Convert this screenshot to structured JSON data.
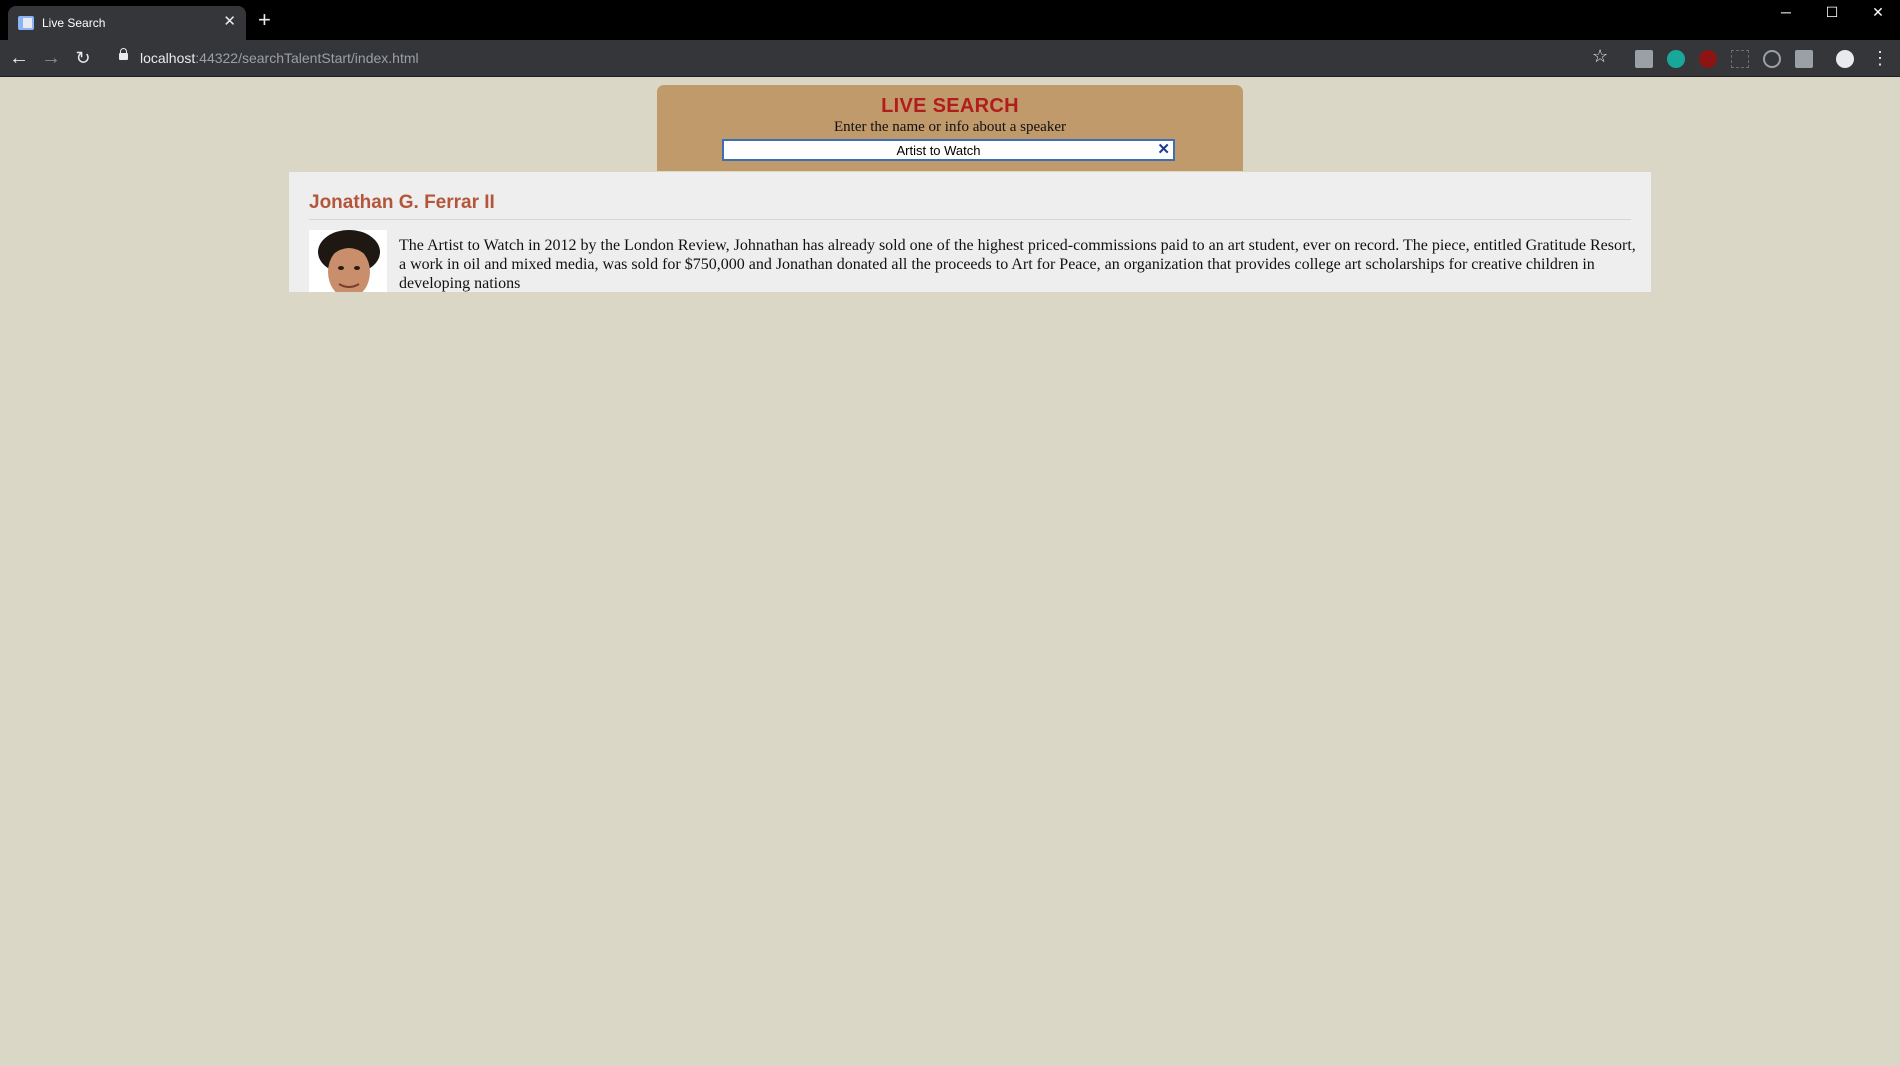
{
  "browser": {
    "tab_title": "Live Search",
    "url_host": "localhost",
    "url_rest": ":44322/searchTalentStart/index.html"
  },
  "search": {
    "heading": "LIVE SEARCH",
    "subheading": "Enter the name or info about a speaker",
    "query": "Artist to Watch"
  },
  "results": [
    {
      "name": "Jonathan G. Ferrar II",
      "bio": "The Artist to Watch in 2012 by the London Review, Johnathan has already sold one of the highest priced-commissions paid to an art student, ever on record. The piece, entitled Gratitude Resort, a work in oil and mixed media, was sold for $750,000 and Jonathan donated all the proceeds to Art for Peace, an organization that provides college art scholarships for creative children in developing nations"
    }
  ],
  "colors": {
    "page_background": "#dad7c6",
    "search_panel": "#c19a6b",
    "heading": "#b31c1c",
    "result_name": "#b5553b"
  }
}
